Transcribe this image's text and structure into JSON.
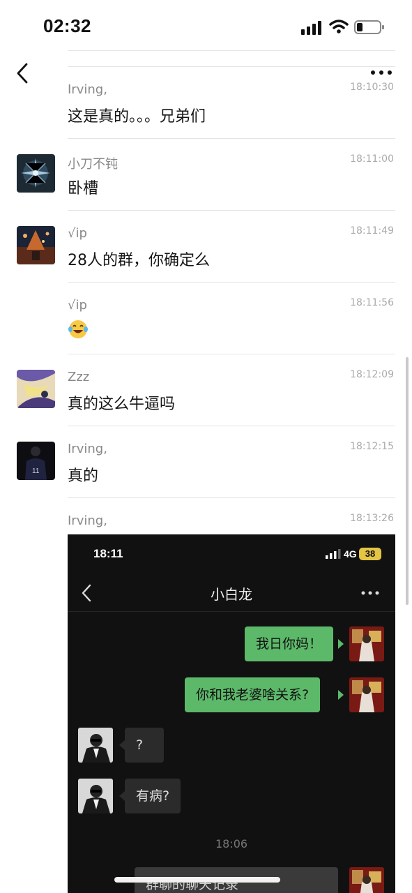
{
  "status_bar": {
    "time": "02:32",
    "icons": [
      "signal-icon",
      "wifi-icon",
      "battery-icon"
    ]
  },
  "nav": {
    "back_icon": "back-chevron-icon",
    "more_icon": "more-dots-icon"
  },
  "messages": [
    {
      "sender": "Irving,",
      "time": "18:10:30",
      "text": "这是真的。。。兄弟们"
    },
    {
      "sender": "小刀不钝",
      "time": "18:11:00",
      "text": "卧槽"
    },
    {
      "sender": "√ip",
      "time": "18:11:49",
      "text": "28人的群，你确定么"
    },
    {
      "sender": "√ip",
      "time": "18:11:56",
      "emoji": "laughing-crying-emoji"
    },
    {
      "sender": "Zzz",
      "time": "18:12:09",
      "text": "真的这么牛逼吗"
    },
    {
      "sender": "Irving,",
      "time": "18:12:15",
      "text": "真的"
    },
    {
      "sender": "Irving,",
      "time": "18:13:26"
    }
  ],
  "embedded_screenshot": {
    "time": "18:11",
    "network": "4G",
    "battery": "38",
    "title": "小白龙",
    "bubbles": [
      {
        "side": "right",
        "text": "我日你妈！"
      },
      {
        "side": "right",
        "text": "你和我老婆啥关系?"
      },
      {
        "side": "left",
        "text": "?"
      },
      {
        "side": "left",
        "text": "有病?"
      },
      {
        "side": "right",
        "text": "群聊的聊天记录"
      }
    ],
    "timestamp": "18:06"
  },
  "colors": {
    "green_bubble": "#5db96a",
    "dark_bg": "#111111",
    "gray_bubble": "#2b2b2b"
  }
}
